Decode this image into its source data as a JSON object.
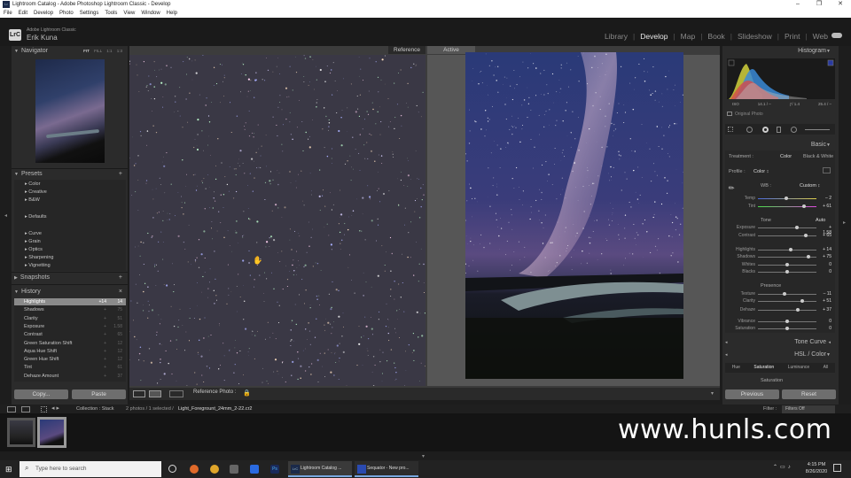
{
  "window": {
    "title": "Lightroom Catalog - Adobe Photoshop Lightroom Classic - Develop",
    "controls": [
      "–",
      "❐",
      "✕"
    ]
  },
  "menu": [
    "File",
    "Edit",
    "Develop",
    "Photo",
    "Settings",
    "Tools",
    "View",
    "Window",
    "Help"
  ],
  "brand": {
    "logo": "LrC",
    "product": "Adobe Lightroom Classic",
    "user": "Erik Kuna"
  },
  "modules": [
    {
      "label": "Library",
      "active": false
    },
    {
      "label": "Develop",
      "active": true
    },
    {
      "label": "Map",
      "active": false
    },
    {
      "label": "Book",
      "active": false
    },
    {
      "label": "Slideshow",
      "active": false
    },
    {
      "label": "Print",
      "active": false
    },
    {
      "label": "Web",
      "active": false
    }
  ],
  "navigator": {
    "title": "Navigator",
    "zoom": [
      "FIT",
      "FILL",
      "1:1",
      "1:3"
    ]
  },
  "presets": {
    "title": "Presets",
    "items": [
      "Color",
      "Creative",
      "B&W",
      "",
      "Defaults",
      "",
      "Curve",
      "Grain",
      "Optics",
      "Sharpening",
      "Vignetting"
    ]
  },
  "snapshots": {
    "title": "Snapshots"
  },
  "history": {
    "title": "History",
    "items": [
      {
        "name": "Highlights",
        "a": "+14",
        "b": "14"
      },
      {
        "name": "Shadows",
        "a": "+",
        "b": "75"
      },
      {
        "name": "Clarity",
        "a": "+",
        "b": "51"
      },
      {
        "name": "Exposure",
        "a": "+",
        "b": "1.58"
      },
      {
        "name": "Contrast",
        "a": "+",
        "b": "65"
      },
      {
        "name": "Green Saturation Shift",
        "a": "+",
        "b": "12"
      },
      {
        "name": "Aqua Hue Shift",
        "a": "+",
        "b": "12"
      },
      {
        "name": "Green Hue Shift",
        "a": "+",
        "b": "12"
      },
      {
        "name": "Tint",
        "a": "+",
        "b": "61"
      },
      {
        "name": "Dehaze Amount",
        "a": "+",
        "b": "37"
      }
    ]
  },
  "left_buttons": {
    "copy": "Copy...",
    "paste": "Paste"
  },
  "view": {
    "reference": "Reference",
    "active": "Active",
    "ref_label": "Reference Photo :"
  },
  "histogram": {
    "title": "Histogram",
    "readout": [
      "ISO",
      "14.1 / –",
      "ƒ/ 1.4",
      "25.4 / –"
    ],
    "original": "Original Photo"
  },
  "basic": {
    "title": "Basic",
    "treatment": "Treatment :",
    "color": "Color",
    "bw": "Black & White",
    "profile": "Profile :",
    "profile_value": "Color ↕",
    "wb": "WB :",
    "wb_value": "Custom ↕",
    "tone": "Tone",
    "auto": "Auto",
    "presence": "Presence"
  },
  "sliders": [
    {
      "label": "Temp",
      "value": "– 2",
      "pos": 0.48
    },
    {
      "label": "Tint",
      "value": "+ 61",
      "pos": 0.78
    },
    {
      "label": "Exposure",
      "value": "+ 1.58",
      "pos": 0.66
    },
    {
      "label": "Contrast",
      "value": "+ 65",
      "pos": 0.82
    },
    {
      "label": "Highlights",
      "value": "+ 14",
      "pos": 0.56
    },
    {
      "label": "Shadows",
      "value": "+ 75",
      "pos": 0.87
    },
    {
      "label": "Whites",
      "value": "0",
      "pos": 0.5
    },
    {
      "label": "Blacks",
      "value": "0",
      "pos": 0.5
    },
    {
      "label": "Texture",
      "value": "– 11",
      "pos": 0.45
    },
    {
      "label": "Clarity",
      "value": "+ 51",
      "pos": 0.75
    },
    {
      "label": "Dehaze",
      "value": "+ 37",
      "pos": 0.68
    },
    {
      "label": "Vibrance",
      "value": "0",
      "pos": 0.5
    },
    {
      "label": "Saturation",
      "value": "0",
      "pos": 0.5
    }
  ],
  "tone_curve": "Tone Curve",
  "hsl": {
    "title": "HSL / Color",
    "tabs": [
      "Hue",
      "Saturation",
      "Luminance",
      "All"
    ],
    "sub": "Saturation"
  },
  "right_buttons": {
    "previous": "Previous",
    "reset": "Reset"
  },
  "filmstrip_bar": {
    "collection": "Collection : Stack",
    "count": "2 photos / 1 selected /",
    "file": "Light_Foregrount_24mm_2-22.cr2",
    "filter": "Filter :",
    "filter_value": "Filters Off"
  },
  "taskbar": {
    "search": "Type here to search",
    "apps": [
      "Lightroom Catalog ...",
      "Sequator - New pro..."
    ],
    "time": "4:15 PM",
    "date": "8/26/2020"
  },
  "watermark": "www.hunls.com",
  "colors": {
    "accent": "#78a8e0",
    "panel": "#2b2b2b",
    "bg": "#1d1d1d"
  }
}
